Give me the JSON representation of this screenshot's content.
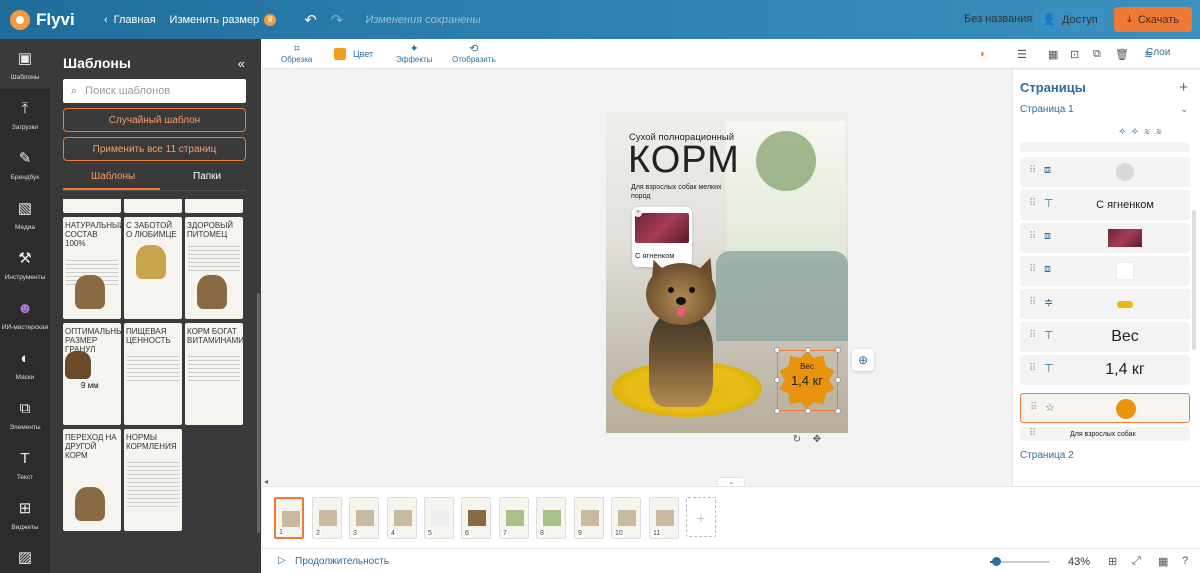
{
  "topbar": {
    "app_name": "Flyvi",
    "home": "Главная",
    "resize": "Изменить размер",
    "saved_status": "Изменения сохранены",
    "doc_name": "Без названия",
    "access": "Доступ",
    "download": "Скачать"
  },
  "sidebar": {
    "items": [
      {
        "label": "Шаблоны",
        "icon": "templates-icon"
      },
      {
        "label": "Загрузки",
        "icon": "upload-icon"
      },
      {
        "label": "Брендбук",
        "icon": "brandbook-icon"
      },
      {
        "label": "Медиа",
        "icon": "media-icon"
      },
      {
        "label": "Инструменты",
        "icon": "tools-icon"
      },
      {
        "label": "ИИ-мастерская",
        "icon": "ai-icon"
      },
      {
        "label": "Маски",
        "icon": "masks-icon"
      },
      {
        "label": "Элементы",
        "icon": "elements-icon"
      },
      {
        "label": "Текст",
        "icon": "text-icon"
      },
      {
        "label": "Виджеты",
        "icon": "widgets-icon"
      }
    ]
  },
  "panel": {
    "title": "Шаблоны",
    "search_placeholder": "Поиск шаблонов",
    "random_btn": "Случайный шаблон",
    "apply_all_btn": "Применить все 11 страниц",
    "tab_templates": "Шаблоны",
    "tab_folders": "Папки",
    "templates": [
      {
        "title": "Натуральный состав 100%"
      },
      {
        "title": "С заботой о любимце"
      },
      {
        "title": "Здоровый питомец"
      },
      {
        "title": "Оптимальный размер гранул"
      },
      {
        "title": "Пищевая ценность"
      },
      {
        "title": "Корм богат витаминами"
      },
      {
        "title": "Переход на другой корм"
      },
      {
        "title": "Нормы кормления"
      }
    ],
    "badge_9mm": "9 мм"
  },
  "toolbar": {
    "crop": "Обрезка",
    "color": "Цвет",
    "color_value": "#f0a020",
    "effects": "Эффекты",
    "flip": "Отобразить",
    "layers": "Слои"
  },
  "design": {
    "subtitle": "Сухой полнорационный",
    "headline": "КОРМ",
    "description": "Для взрослых собак мелких пород",
    "card_label": "С ягненком",
    "badge_label": "Вес",
    "badge_value": "1,4 кг"
  },
  "right_panel": {
    "title": "Страницы",
    "page1": "Страница 1",
    "page2": "Страница 2",
    "layers": [
      {
        "icon": "shape-icon",
        "preview": "",
        "type": "circle"
      },
      {
        "icon": "text-layer-icon",
        "preview": "С ягненком",
        "type": "text"
      },
      {
        "icon": "image-layer-icon",
        "preview": "",
        "type": "image"
      },
      {
        "icon": "shape-icon",
        "preview": "",
        "type": "white"
      },
      {
        "icon": "filter-icon",
        "preview": "",
        "type": "pill"
      },
      {
        "icon": "text-layer-icon",
        "preview": "Вес",
        "type": "bigtext"
      },
      {
        "icon": "text-layer-icon",
        "preview": "1,4 кг",
        "type": "bigtext"
      },
      {
        "icon": "star-icon",
        "preview": "",
        "type": "badge"
      },
      {
        "icon": "text-layer-icon",
        "preview": "Для взрослых собак",
        "type": "small"
      }
    ]
  },
  "pages_strip": {
    "pages": [
      "1",
      "2",
      "3",
      "4",
      "5",
      "6",
      "7",
      "8",
      "9",
      "10",
      "11"
    ]
  },
  "bottom": {
    "duration": "Продолжительность",
    "zoom": "43%"
  }
}
